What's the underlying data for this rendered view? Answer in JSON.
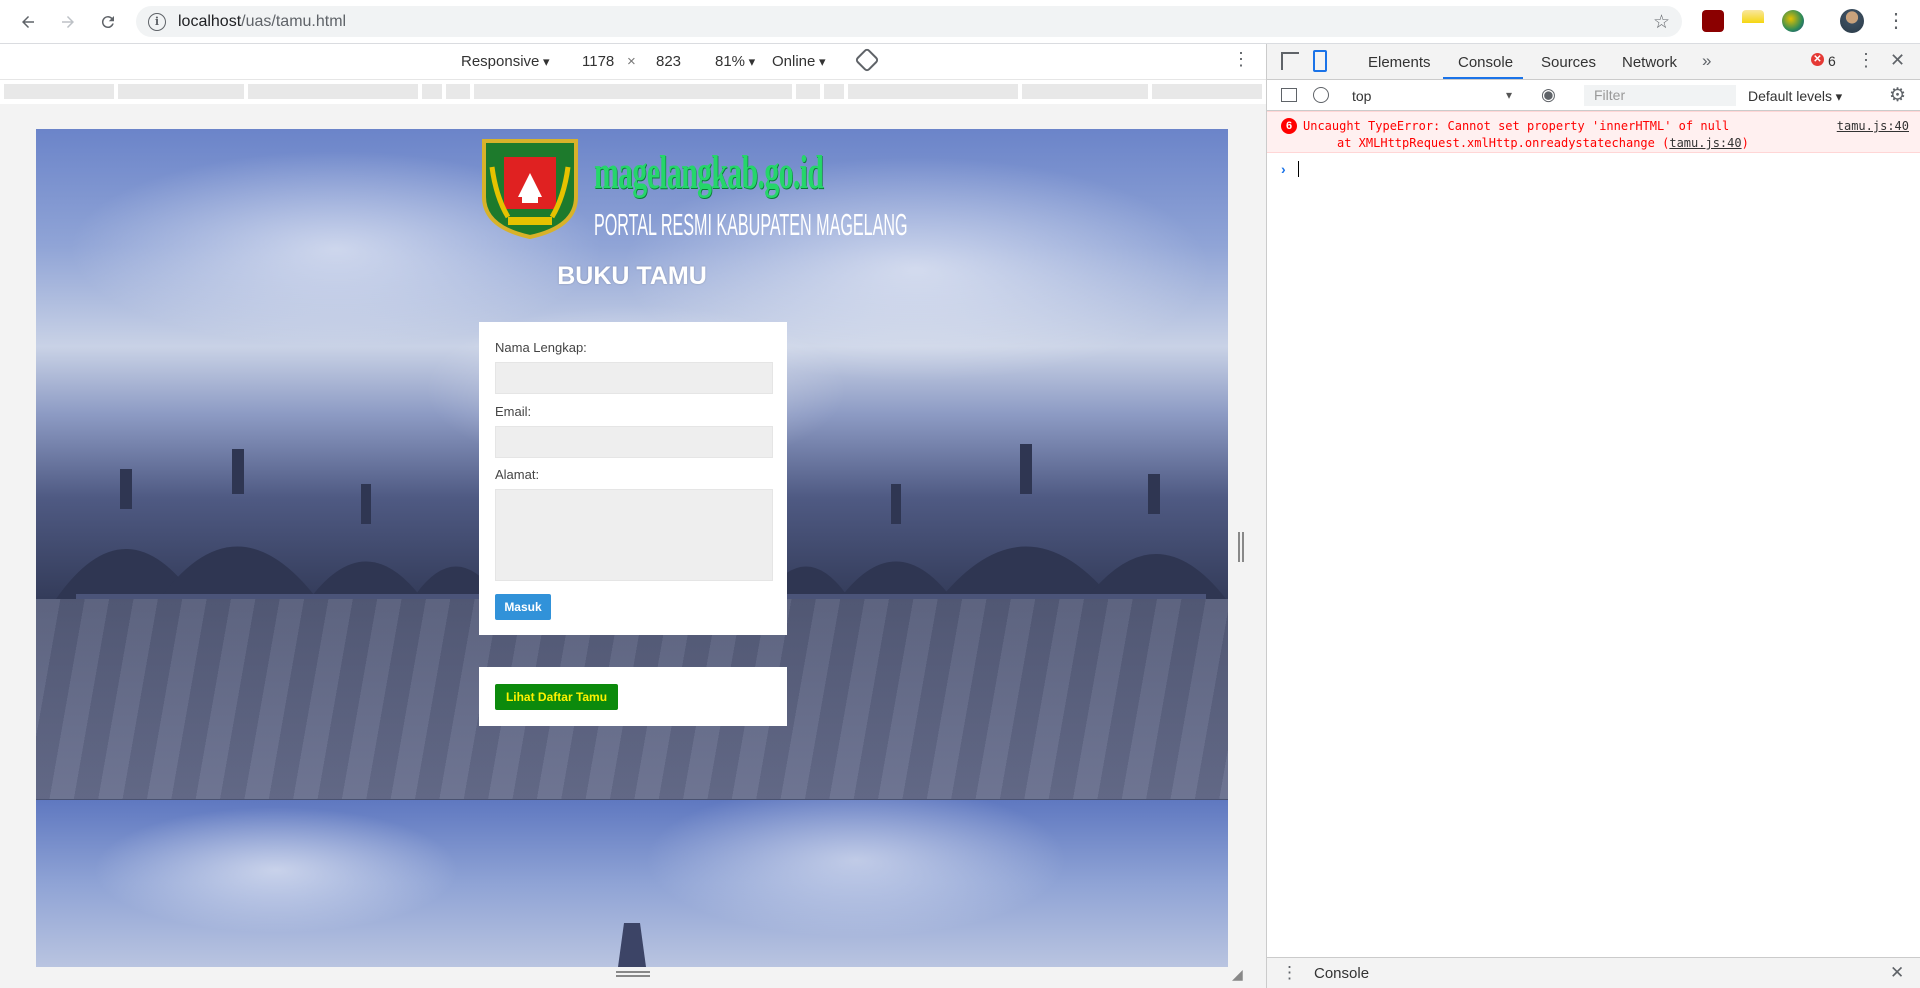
{
  "browser": {
    "url_host": "localhost",
    "url_path": "/uas/tamu.html"
  },
  "device_toolbar": {
    "device": "Responsive",
    "width": "1178",
    "times": "×",
    "height": "823",
    "zoom": "81%",
    "network": "Online"
  },
  "page": {
    "logo_title": "magelangkab.go.id",
    "logo_subtitle": "PORTAL RESMI KABUPATEN MAGELANG",
    "title": "BUKU TAMU",
    "form": {
      "name_label": "Nama Lengkap:",
      "email_label": "Email:",
      "address_label": "Alamat:",
      "submit_label": "Masuk"
    },
    "view_list_label": "Lihat Daftar Tamu"
  },
  "devtools": {
    "tabs": [
      "Elements",
      "Console",
      "Sources",
      "Network"
    ],
    "active_tab": "Console",
    "error_count": "6",
    "context": "top",
    "filter_placeholder": "Filter",
    "levels": "Default levels",
    "message": {
      "count": "6",
      "text": "Uncaught TypeError: Cannot set property 'innerHTML' of null",
      "source": "tamu.js:40",
      "stack_prefix": "at XMLHttpRequest.xmlHttp.onreadystatechange (",
      "stack_link": "tamu.js:40",
      "stack_suffix": ")"
    },
    "drawer_title": "Console"
  },
  "colors": {
    "accent": "#1a73e8",
    "masuk_button": "#3192d9",
    "lihat_button": "#0c8a0c",
    "error_red": "#ff0000"
  }
}
